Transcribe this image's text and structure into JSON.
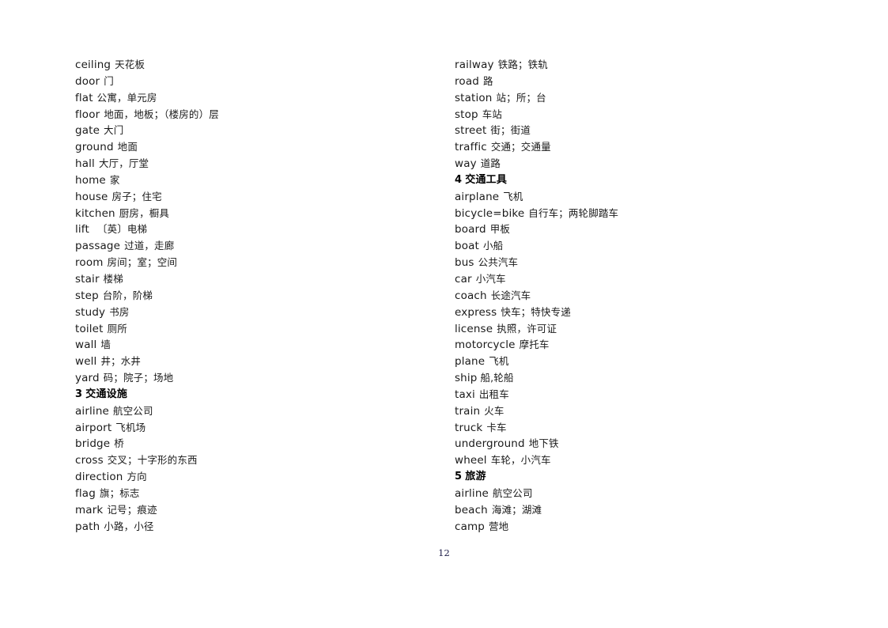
{
  "document": {
    "page_number": "12",
    "background_color": "#ffffff",
    "text_color": "#1a1a1a"
  },
  "columns": {
    "left": [
      {
        "type": "entry",
        "term": "ceiling",
        "gloss": "天花板"
      },
      {
        "type": "entry",
        "term": "door",
        "gloss": "门"
      },
      {
        "type": "entry",
        "term": "flat",
        "gloss": "公寓，单元房"
      },
      {
        "type": "entry",
        "term": "floor",
        "gloss": "地面，地板；（楼房的）层"
      },
      {
        "type": "entry",
        "term": "gate",
        "gloss": "大门"
      },
      {
        "type": "entry",
        "term": "ground",
        "gloss": "地面"
      },
      {
        "type": "entry",
        "term": "hall",
        "gloss": "大厅，厅堂"
      },
      {
        "type": "entry",
        "term": "home",
        "gloss": "家"
      },
      {
        "type": "entry",
        "term": "house",
        "gloss": "房子；住宅"
      },
      {
        "type": "entry",
        "term": "kitchen",
        "gloss": "厨房，橱具"
      },
      {
        "type": "entry",
        "term": "lift",
        "gloss": "〔英〕电梯",
        "gap": "wide"
      },
      {
        "type": "entry",
        "term": "passage",
        "gloss": "过道，走廊"
      },
      {
        "type": "entry",
        "term": "room",
        "gloss": "房间；室；空间"
      },
      {
        "type": "entry",
        "term": "stair",
        "gloss": "楼梯"
      },
      {
        "type": "entry",
        "term": "step",
        "gloss": "台阶，阶梯"
      },
      {
        "type": "entry",
        "term": "study",
        "gloss": "书房"
      },
      {
        "type": "entry",
        "term": "toilet",
        "gloss": "厕所"
      },
      {
        "type": "entry",
        "term": "wall",
        "gloss": "墙"
      },
      {
        "type": "entry",
        "term": "well",
        "gloss": "井；水井"
      },
      {
        "type": "entry",
        "term": "yard",
        "gloss": "码；院子；场地"
      },
      {
        "type": "heading",
        "number": "3",
        "title": "交通设施"
      },
      {
        "type": "entry",
        "term": "airline",
        "gloss": "航空公司"
      },
      {
        "type": "entry",
        "term": "airport",
        "gloss": "飞机场"
      },
      {
        "type": "entry",
        "term": "bridge",
        "gloss": "桥"
      },
      {
        "type": "entry",
        "term": "cross",
        "gloss": "交叉；十字形的东西"
      },
      {
        "type": "entry",
        "term": "direction",
        "gloss": "方向"
      },
      {
        "type": "entry",
        "term": "flag",
        "gloss": "旗；标志"
      },
      {
        "type": "entry",
        "term": "mark",
        "gloss": "记号；痕迹"
      },
      {
        "type": "entry",
        "term": "path",
        "gloss": "小路，小径"
      }
    ],
    "right": [
      {
        "type": "entry",
        "term": "railway",
        "gloss": "铁路；铁轨"
      },
      {
        "type": "entry",
        "term": "road",
        "gloss": "路"
      },
      {
        "type": "entry",
        "term": "station",
        "gloss": "站；所；台"
      },
      {
        "type": "entry",
        "term": "stop",
        "gloss": "车站"
      },
      {
        "type": "entry",
        "term": "street",
        "gloss": "街；街道"
      },
      {
        "type": "entry",
        "term": "traffic",
        "gloss": "交通；交通量"
      },
      {
        "type": "entry",
        "term": "way",
        "gloss": "道路"
      },
      {
        "type": "heading",
        "number": "4",
        "title": "交通工具"
      },
      {
        "type": "entry",
        "term": "airplane",
        "gloss": "飞机"
      },
      {
        "type": "entry",
        "term": "bicycle=bike",
        "gloss": "自行车；两轮脚踏车"
      },
      {
        "type": "entry",
        "term": "board",
        "gloss": "甲板"
      },
      {
        "type": "entry",
        "term": "boat",
        "gloss": "小船"
      },
      {
        "type": "entry",
        "term": "bus",
        "gloss": "公共汽车"
      },
      {
        "type": "entry",
        "term": "car",
        "gloss": "小汽车"
      },
      {
        "type": "entry",
        "term": "coach",
        "gloss": "长途汽车"
      },
      {
        "type": "entry",
        "term": "express",
        "gloss": "快车；特快专递"
      },
      {
        "type": "entry",
        "term": "license",
        "gloss": "执照，许可证"
      },
      {
        "type": "entry",
        "term": "motorcycle",
        "gloss": "摩托车"
      },
      {
        "type": "entry",
        "term": "plane",
        "gloss": "飞机"
      },
      {
        "type": "entry",
        "term": "ship",
        "gloss": "船,轮船",
        "gap": "tight"
      },
      {
        "type": "entry",
        "term": "taxi",
        "gloss": "出租车"
      },
      {
        "type": "entry",
        "term": "train",
        "gloss": "火车"
      },
      {
        "type": "entry",
        "term": "truck",
        "gloss": "卡车"
      },
      {
        "type": "entry",
        "term": "underground",
        "gloss": "地下铁"
      },
      {
        "type": "entry",
        "term": "wheel",
        "gloss": "车轮，小汽车"
      },
      {
        "type": "heading",
        "number": "5",
        "title": "旅游"
      },
      {
        "type": "entry",
        "term": "airline",
        "gloss": "航空公司"
      },
      {
        "type": "entry",
        "term": "beach",
        "gloss": "海滩；湖滩"
      },
      {
        "type": "entry",
        "term": "camp",
        "gloss": "营地"
      }
    ]
  }
}
